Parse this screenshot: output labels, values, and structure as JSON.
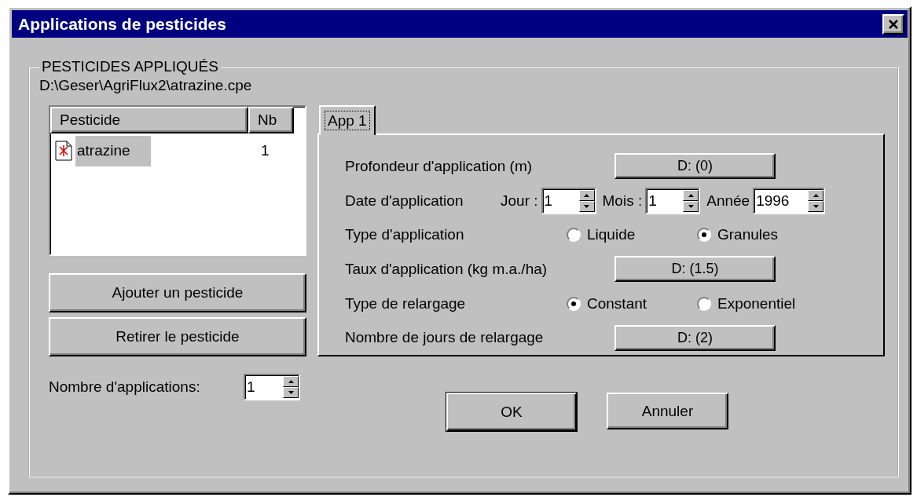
{
  "window": {
    "title": "Applications de pesticides"
  },
  "group": {
    "legend": "PESTICIDES APPLIQUÉS",
    "path": "D:\\Geser\\AgriFlux2\\atrazine.cpe"
  },
  "pesticide_list": {
    "columns": [
      "Pesticide",
      "Nb"
    ],
    "rows": [
      {
        "name": "atrazine",
        "nb": "1",
        "selected": true
      }
    ]
  },
  "list_buttons": [
    "Ajouter un pesticide",
    "Retirer le pesticide"
  ],
  "applications_count": {
    "label": "Nombre d'applications:",
    "value": "1"
  },
  "tabs": [
    {
      "label": "App 1",
      "selected": true
    }
  ],
  "fields": [
    {
      "kind": "value",
      "label": "Profondeur d'application (m)",
      "value": "D: (0)"
    },
    {
      "kind": "date",
      "label": "Date d'application",
      "parts": [
        {
          "label": "Jour :",
          "value": "1"
        },
        {
          "label": "Mois :",
          "value": "1"
        },
        {
          "label": "Année",
          "value": "1996"
        }
      ]
    },
    {
      "kind": "radio",
      "label": "Type d'application",
      "options": [
        {
          "label": "Liquide",
          "selected": false
        },
        {
          "label": "Granules",
          "selected": true
        }
      ]
    },
    {
      "kind": "value",
      "label": "Taux d'application (kg m.a./ha)",
      "value": "D: (1.5)"
    },
    {
      "kind": "radio",
      "label": "Type de relargage",
      "options": [
        {
          "label": "Constant",
          "selected": true
        },
        {
          "label": "Exponentiel",
          "selected": false
        }
      ]
    },
    {
      "kind": "value",
      "label": "Nombre de jours de relargage",
      "value": "D: (2)"
    }
  ],
  "buttons": [
    "OK",
    "Annuler"
  ]
}
